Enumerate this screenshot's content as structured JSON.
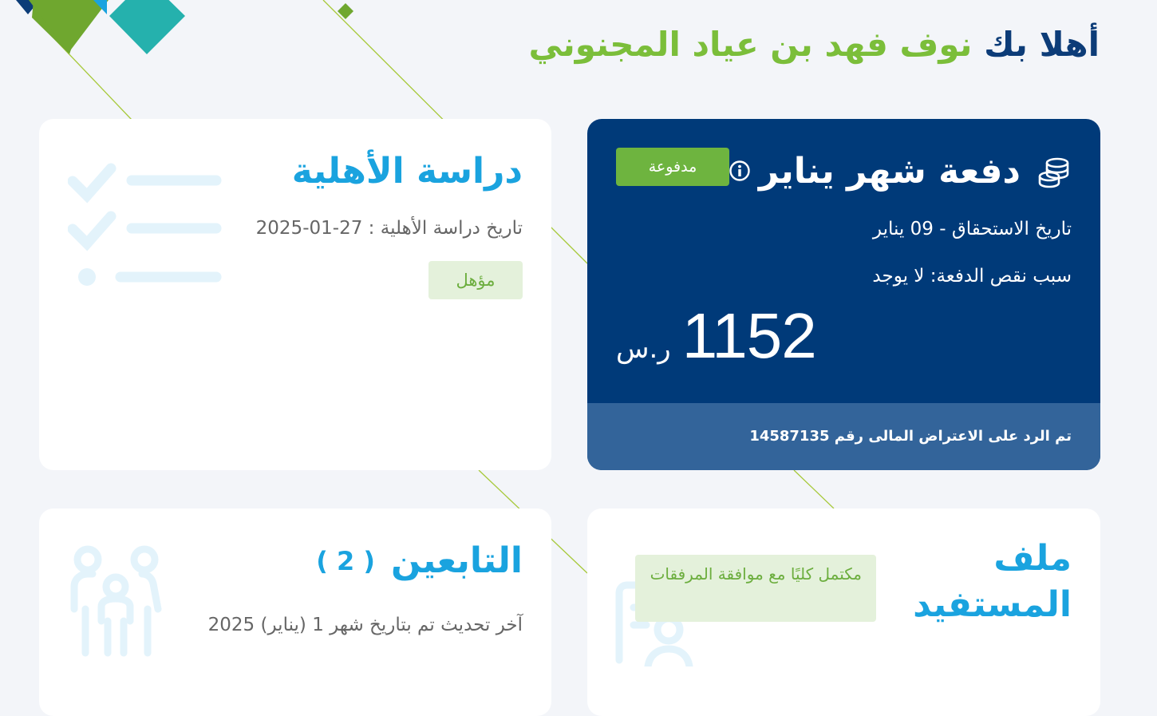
{
  "greeting": {
    "prefix": "أهلا بك",
    "name": "نوف فهد بن عياد المجنوني"
  },
  "payment_card": {
    "title": "دفعة شهر يناير",
    "status_badge": "مدفوعة",
    "due_date": "تاريخ الاستحقاق - 09 يناير",
    "shortfall_reason": "سبب نقص الدفعة: لا يوجد",
    "amount": "1152",
    "currency": "ر.س",
    "footer_note": "تم الرد على الاعتراض المالى رقم 14587135"
  },
  "eligibility_card": {
    "title": "دراسة الأهلية",
    "study_date": "تاريخ دراسة الأهلية : 27-01-2025",
    "status_badge": "مؤهل"
  },
  "dependents_card": {
    "title": "التابعين",
    "count": "( 2 )",
    "last_update": "آخر تحديث تم بتاريخ شهر 1 (يناير) 2025"
  },
  "beneficiary_card": {
    "title": "ملف المستفيد",
    "status_badge": "مكتمل كليًا مع موافقة المرفقات"
  },
  "colors": {
    "navy": "#003a79",
    "navy_footer": "#33649a",
    "accent_blue": "#1aa3df",
    "green": "#6eb43f",
    "light_green_bg": "#e4f1db",
    "page_bg": "#f3f5f9"
  },
  "icons": [
    "coins-icon",
    "info-icon",
    "checklist-icon",
    "family-icon",
    "profile-icon"
  ]
}
